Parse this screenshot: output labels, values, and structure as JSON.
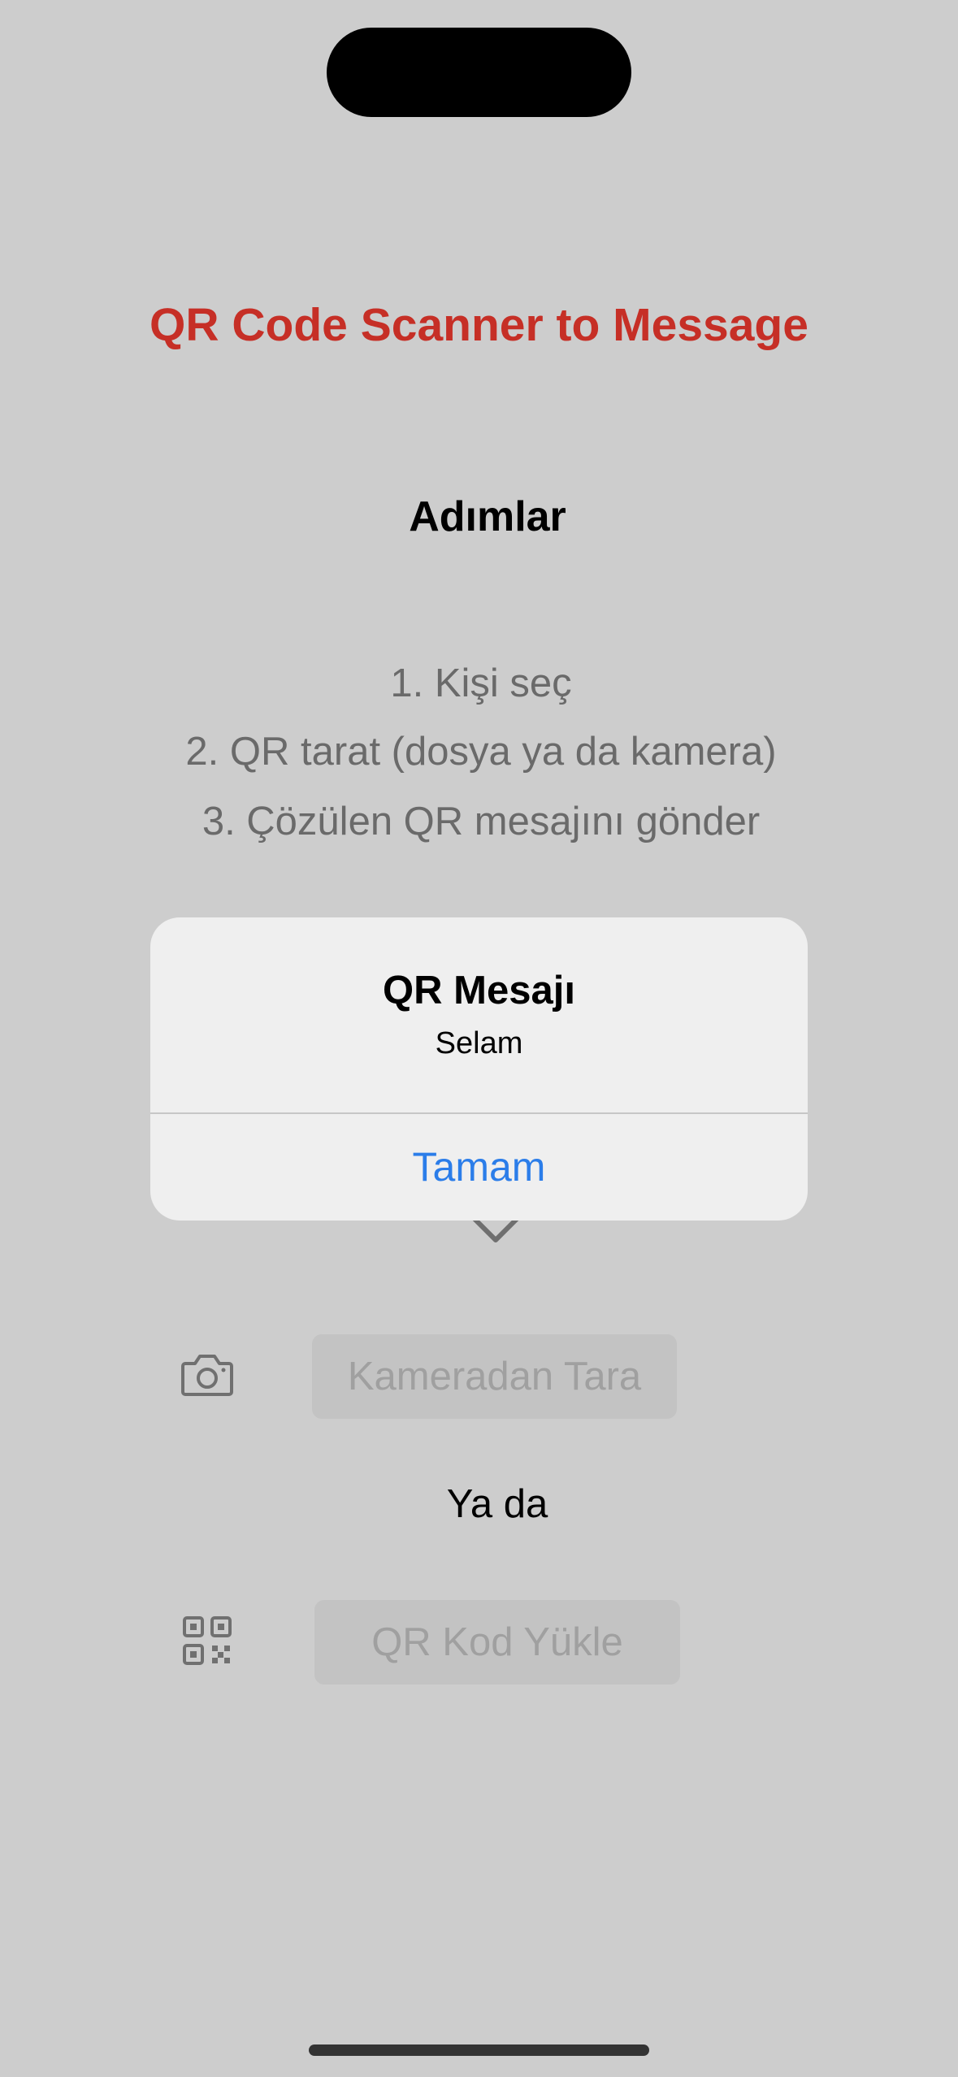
{
  "app": {
    "title": "QR Code Scanner to Message"
  },
  "steps": {
    "title": "Adımlar",
    "items": [
      "1. Kişi seç",
      "2. QR tarat (dosya ya da kamera)",
      "3. Çözülen QR mesajını gönder"
    ]
  },
  "actions": {
    "camera_button": "Kameradan Tara",
    "or_text": "Ya da",
    "upload_button": "QR Kod Yükle",
    "camera_icon": "camera-icon",
    "qr_icon": "qr-code-icon",
    "arrow_icon": "chevron-down-icon"
  },
  "alert": {
    "title": "QR Mesajı",
    "message": "Selam",
    "ok_button": "Tamam"
  },
  "colors": {
    "background": "#cdcdcd",
    "title": "#c62f26",
    "accent": "#2b7de9"
  }
}
